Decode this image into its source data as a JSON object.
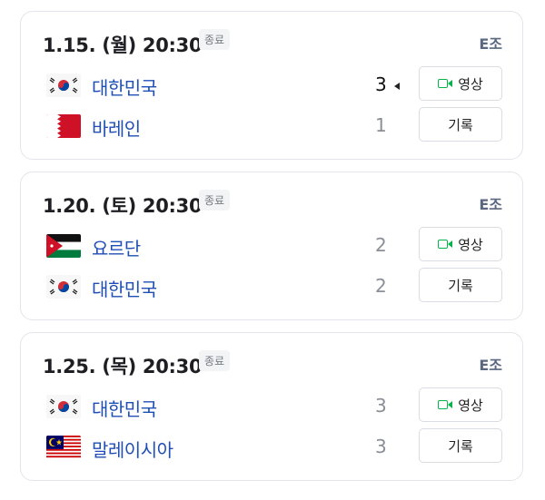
{
  "colors": {
    "team_link": "#1f4eb4",
    "video_icon": "#06b24a",
    "group_text": "#5b6680",
    "card_border": "#e3e5ea"
  },
  "matches": [
    {
      "date": "1.15. (월) 20:30",
      "status": "종료",
      "group": "E조",
      "teams": [
        {
          "name": "대한민국",
          "flag": "korea-flag",
          "score": "3",
          "winner": true
        },
        {
          "name": "바레인",
          "flag": "bahrain-flag",
          "score": "1",
          "winner": false
        }
      ],
      "video_label": "영상",
      "record_label": "기록"
    },
    {
      "date": "1.20. (토) 20:30",
      "status": "종료",
      "group": "E조",
      "teams": [
        {
          "name": "요르단",
          "flag": "jordan-flag",
          "score": "2",
          "winner": false
        },
        {
          "name": "대한민국",
          "flag": "korea-flag",
          "score": "2",
          "winner": false
        }
      ],
      "video_label": "영상",
      "record_label": "기록"
    },
    {
      "date": "1.25. (목) 20:30",
      "status": "종료",
      "group": "E조",
      "teams": [
        {
          "name": "대한민국",
          "flag": "korea-flag",
          "score": "3",
          "winner": false
        },
        {
          "name": "말레이시아",
          "flag": "malaysia-flag",
          "score": "3",
          "winner": false
        }
      ],
      "video_label": "영상",
      "record_label": "기록"
    }
  ]
}
